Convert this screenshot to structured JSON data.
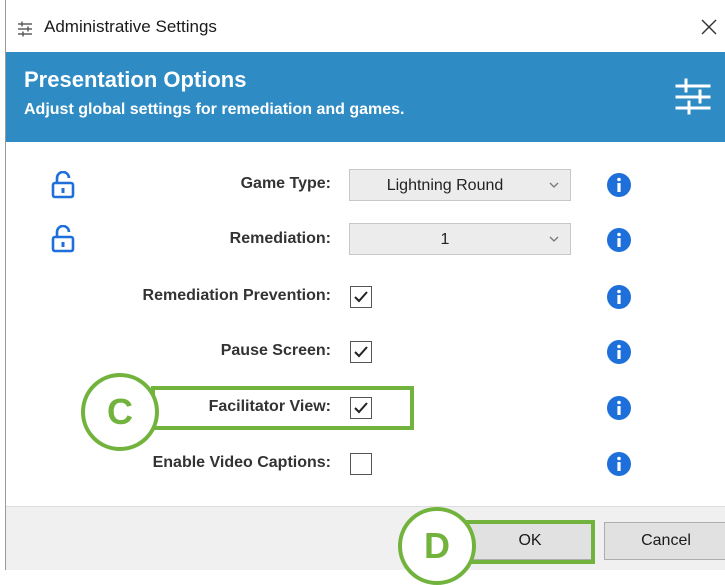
{
  "window": {
    "title": "Administrative Settings",
    "title_icon": "sliders-icon",
    "close_icon": "close-icon"
  },
  "header": {
    "title": "Presentation Options",
    "subtitle": "Adjust global settings for remediation and games.",
    "background_color": "#2e8bc4",
    "icon": "sliders-icon"
  },
  "settings": {
    "game_type": {
      "label": "Game Type:",
      "value": "Lightning Round",
      "locked_icon": "unlock-icon"
    },
    "remediation": {
      "label": "Remediation:",
      "value": "1",
      "locked_icon": "unlock-icon"
    },
    "remediation_prevention": {
      "label": "Remediation Prevention:",
      "checked": true
    },
    "pause_screen": {
      "label": "Pause Screen:",
      "checked": true
    },
    "facilitator_view": {
      "label": "Facilitator View:",
      "checked": true
    },
    "enable_video_captions": {
      "label": "Enable Video Captions:",
      "checked": false
    }
  },
  "annotations": {
    "c_label": "C",
    "d_label": "D",
    "highlight_color": "#72b33e"
  },
  "footer": {
    "ok_label": "OK",
    "cancel_label": "Cancel"
  },
  "colors": {
    "accent_blue": "#2e8bc4",
    "info_blue": "#1e6fd9"
  }
}
